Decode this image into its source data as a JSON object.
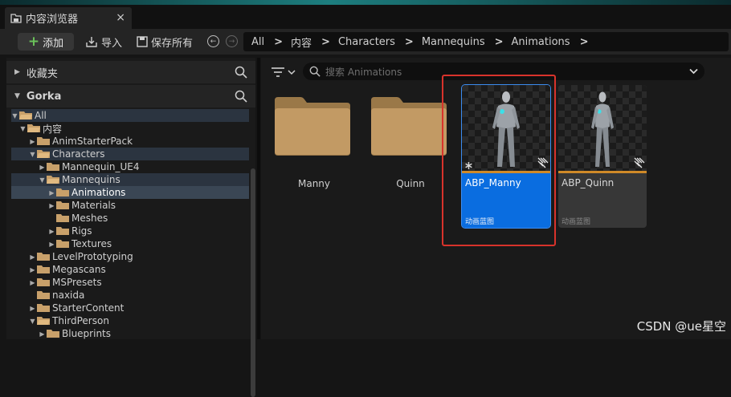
{
  "window": {
    "tab_title": "内容浏览器",
    "close_glyph": "×"
  },
  "toolbar": {
    "add_plus": "+",
    "add_label": "添加",
    "import_label": "导入",
    "save_all_label": "保存所有",
    "back_glyph": "←",
    "forward_glyph": "→"
  },
  "breadcrumb": {
    "items": [
      "All",
      "内容",
      "Characters",
      "Mannequins",
      "Animations"
    ],
    "separator": ">"
  },
  "sidebar": {
    "favorites_label": "收藏夹",
    "project_label": "Gorka",
    "tree": [
      {
        "label": "All",
        "expanded": true
      },
      {
        "label": "内容",
        "expanded": true
      },
      {
        "label": "AnimStarterPack",
        "expanded": false
      },
      {
        "label": "Characters",
        "expanded": true
      },
      {
        "label": "Mannequin_UE4",
        "expanded": false
      },
      {
        "label": "Mannequins",
        "expanded": true
      },
      {
        "label": "Animations",
        "expanded": false
      },
      {
        "label": "Materials",
        "expanded": false
      },
      {
        "label": "Meshes",
        "expanded": false
      },
      {
        "label": "Rigs",
        "expanded": false
      },
      {
        "label": "Textures",
        "expanded": false
      },
      {
        "label": "LevelPrototyping",
        "expanded": false
      },
      {
        "label": "Megascans",
        "expanded": false
      },
      {
        "label": "MSPresets",
        "expanded": false
      },
      {
        "label": "naxida",
        "expanded": false
      },
      {
        "label": "StarterContent",
        "expanded": false
      },
      {
        "label": "ThirdPerson",
        "expanded": true
      },
      {
        "label": "Blueprints",
        "expanded": false
      }
    ]
  },
  "content": {
    "search_placeholder": "搜索 Animations",
    "folders": [
      {
        "label": "Manny"
      },
      {
        "label": "Quinn"
      }
    ],
    "assets": [
      {
        "name": "ABP_Manny",
        "type": "动画蓝图",
        "selected": true
      },
      {
        "name": "ABP_Quinn",
        "type": "动画蓝图",
        "selected": false
      }
    ]
  },
  "colors": {
    "folder": "#c29a64",
    "folder_tree": "#c8a06a",
    "selection": "#0a6de0",
    "highlight_box": "#d8332b",
    "asset_bar": "#d08a28"
  },
  "watermark": "CSDN @ue星空"
}
